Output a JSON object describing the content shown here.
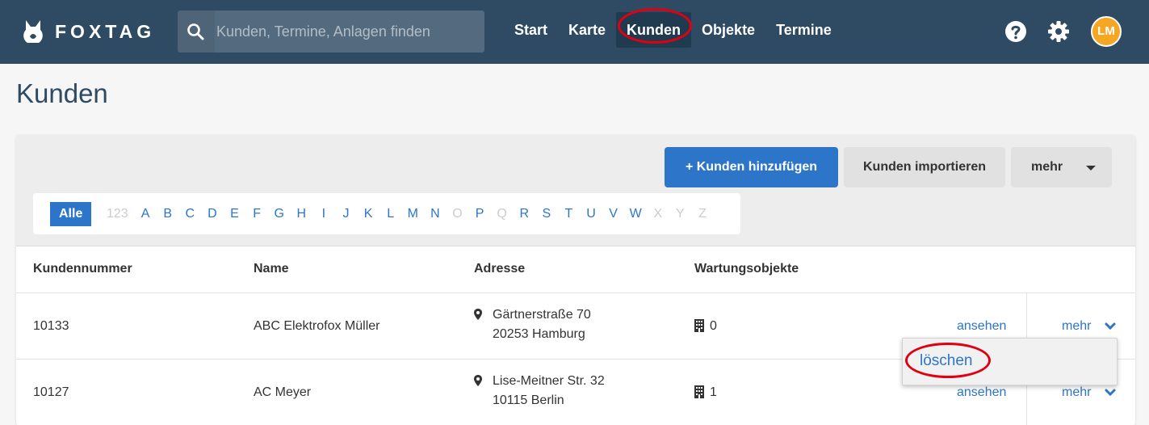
{
  "app": {
    "brand": "FOXTAG",
    "accent_color": "#2d75c8",
    "header_color": "#2f4b63",
    "highlight_color": "#e00010"
  },
  "search": {
    "placeholder": "Kunden, Termine, Anlagen finden",
    "icon": "search-icon"
  },
  "nav": {
    "items": [
      {
        "label": "Start"
      },
      {
        "label": "Karte"
      },
      {
        "label": "Kunden",
        "active": true
      },
      {
        "label": "Objekte"
      },
      {
        "label": "Termine"
      }
    ]
  },
  "header_icons": {
    "help": "help-icon",
    "settings": "gear-icon",
    "avatar_initials": "LM"
  },
  "page": {
    "title": "Kunden"
  },
  "toolbar": {
    "add_plus": "+",
    "add_label": "Kunden hinzufügen",
    "import_label": "Kunden importieren",
    "more_label": "mehr"
  },
  "alphabet": {
    "all_label": "Alle",
    "numeric": "123",
    "letters": [
      {
        "l": "A",
        "on": true
      },
      {
        "l": "B",
        "on": true
      },
      {
        "l": "C",
        "on": true
      },
      {
        "l": "D",
        "on": true
      },
      {
        "l": "E",
        "on": true
      },
      {
        "l": "F",
        "on": true
      },
      {
        "l": "G",
        "on": true
      },
      {
        "l": "H",
        "on": true
      },
      {
        "l": "I",
        "on": true
      },
      {
        "l": "J",
        "on": true
      },
      {
        "l": "K",
        "on": true
      },
      {
        "l": "L",
        "on": true
      },
      {
        "l": "M",
        "on": true
      },
      {
        "l": "N",
        "on": true
      },
      {
        "l": "O",
        "on": false
      },
      {
        "l": "P",
        "on": true
      },
      {
        "l": "Q",
        "on": false
      },
      {
        "l": "R",
        "on": true
      },
      {
        "l": "S",
        "on": true
      },
      {
        "l": "T",
        "on": true
      },
      {
        "l": "U",
        "on": true
      },
      {
        "l": "V",
        "on": true
      },
      {
        "l": "W",
        "on": true
      },
      {
        "l": "X",
        "on": false
      },
      {
        "l": "Y",
        "on": false
      },
      {
        "l": "Z",
        "on": false
      }
    ]
  },
  "table": {
    "columns": [
      "Kundennummer",
      "Name",
      "Adresse",
      "Wartungsobjekte"
    ],
    "rows": [
      {
        "number": "10133",
        "name": "ABC Elektrofox Müller",
        "street": "Gärtnerstraße 70",
        "city": "20253 Hamburg",
        "objects": "0",
        "view": "ansehen",
        "more": "mehr"
      },
      {
        "number": "10127",
        "name": "AC Meyer",
        "street": "Lise-Meitner Str. 32",
        "city": "10115 Berlin",
        "objects": "1",
        "view": "ansehen",
        "more": "mehr"
      }
    ]
  },
  "dropdown": {
    "delete_label": "löschen"
  }
}
